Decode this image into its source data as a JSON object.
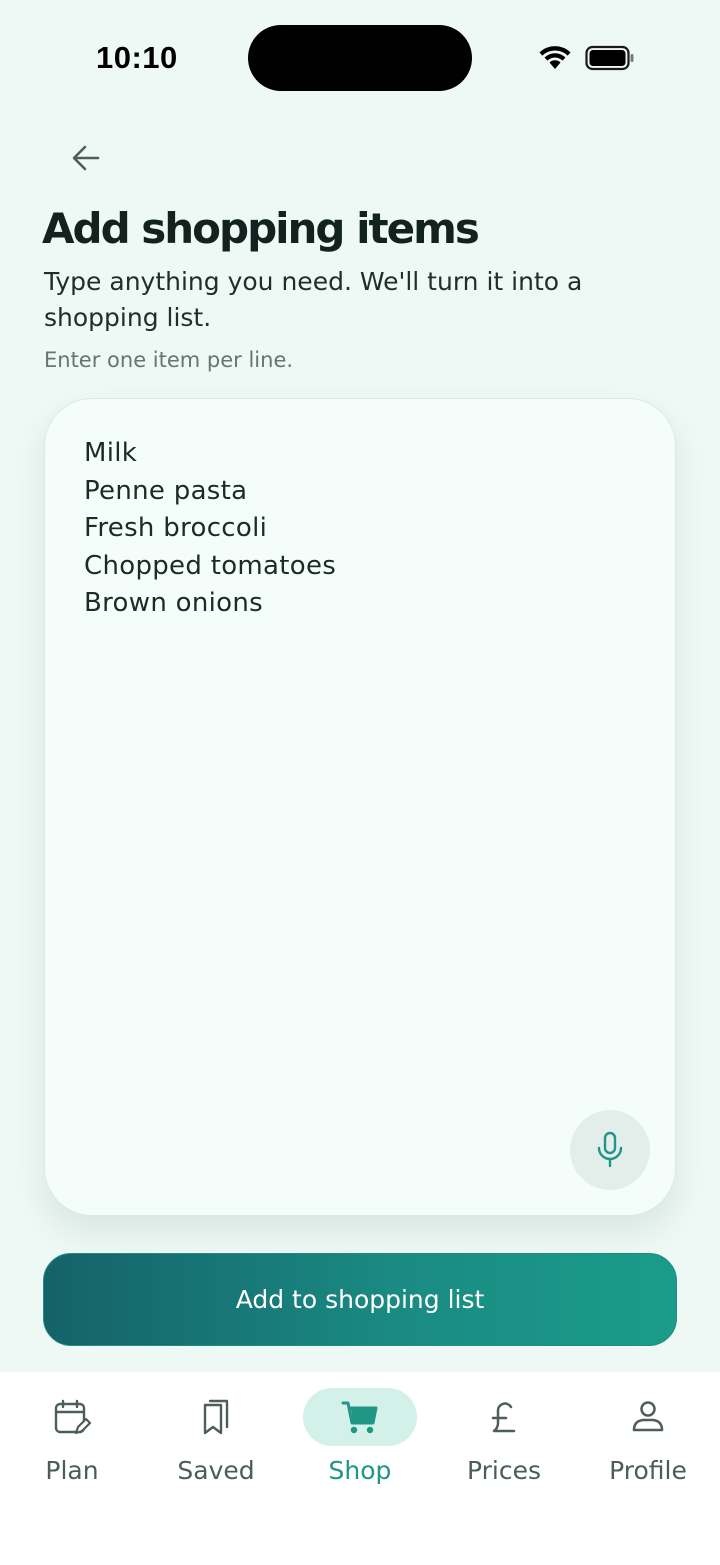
{
  "status_bar": {
    "time": "10:10",
    "icons": [
      "wifi-icon",
      "battery-icon"
    ]
  },
  "header": {
    "back_icon": "arrow-left-icon",
    "title": "Add shopping items",
    "subtitle": "Type anything you need. We'll turn it into a shopping list.",
    "hint": "Enter one item per line."
  },
  "input": {
    "items": [
      "Milk",
      "Penne pasta",
      "Fresh broccoli",
      "Chopped tomatoes",
      "Brown onions"
    ],
    "mic_icon": "microphone-icon"
  },
  "cta": {
    "label": "Add to shopping list"
  },
  "tabs": [
    {
      "label": "Plan",
      "icon": "calendar-edit-icon",
      "active": false
    },
    {
      "label": "Saved",
      "icon": "bookmark-icon",
      "active": false
    },
    {
      "label": "Shop",
      "icon": "cart-icon",
      "active": true
    },
    {
      "label": "Prices",
      "icon": "pound-icon",
      "active": false
    },
    {
      "label": "Profile",
      "icon": "person-icon",
      "active": false
    }
  ],
  "colors": {
    "background": "#eef8f4",
    "accent": "#1f9686",
    "cta_gradient_start": "#15616a",
    "cta_gradient_end": "#1a9c8a",
    "active_tab_pill": "#d3f1e9"
  }
}
